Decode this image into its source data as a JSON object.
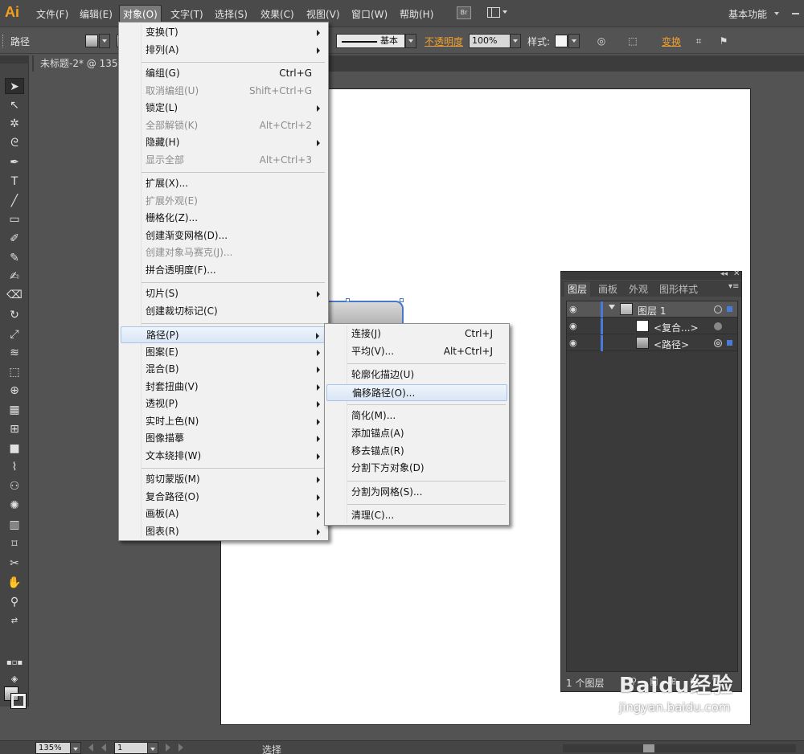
{
  "app": {
    "logo": "Ai",
    "workspace": "基本功能",
    "br_label": "Br"
  },
  "menubar": [
    "文件(F)",
    "编辑(E)",
    "对象(O)",
    "文字(T)",
    "选择(S)",
    "效果(C)",
    "视图(V)",
    "窗口(W)",
    "帮助(H)"
  ],
  "control": {
    "path_label": "路径",
    "stroke_style": "基本",
    "opacity_label": "不透明度",
    "opacity_value": "100%",
    "style_label": "样式:",
    "transform_label": "变换"
  },
  "document_tab": "未标题-2* @ 135%",
  "object_menu": [
    {
      "label": "变换(T)",
      "submenu": true
    },
    {
      "label": "排列(A)",
      "submenu": true
    },
    {
      "sep": true
    },
    {
      "label": "编组(G)",
      "shortcut": "Ctrl+G"
    },
    {
      "label": "取消编组(U)",
      "shortcut": "Shift+Ctrl+G",
      "disabled": true
    },
    {
      "label": "锁定(L)",
      "submenu": true
    },
    {
      "label": "全部解锁(K)",
      "shortcut": "Alt+Ctrl+2",
      "disabled": true
    },
    {
      "label": "隐藏(H)",
      "submenu": true
    },
    {
      "label": "显示全部",
      "shortcut": "Alt+Ctrl+3",
      "disabled": true
    },
    {
      "sep": true
    },
    {
      "label": "扩展(X)..."
    },
    {
      "label": "扩展外观(E)",
      "disabled": true
    },
    {
      "label": "栅格化(Z)..."
    },
    {
      "label": "创建渐变网格(D)..."
    },
    {
      "label": "创建对象马赛克(J)...",
      "disabled": true
    },
    {
      "label": "拼合透明度(F)..."
    },
    {
      "sep": true
    },
    {
      "label": "切片(S)",
      "submenu": true
    },
    {
      "label": "创建裁切标记(C)"
    },
    {
      "sep": true
    },
    {
      "label": "路径(P)",
      "submenu": true,
      "highlighted": true
    },
    {
      "label": "图案(E)",
      "submenu": true
    },
    {
      "label": "混合(B)",
      "submenu": true
    },
    {
      "label": "封套扭曲(V)",
      "submenu": true
    },
    {
      "label": "透视(P)",
      "submenu": true
    },
    {
      "label": "实时上色(N)",
      "submenu": true
    },
    {
      "label": "图像描摹",
      "submenu": true
    },
    {
      "label": "文本绕排(W)",
      "submenu": true
    },
    {
      "sep": true
    },
    {
      "label": "剪切蒙版(M)",
      "submenu": true
    },
    {
      "label": "复合路径(O)",
      "submenu": true
    },
    {
      "label": "画板(A)",
      "submenu": true
    },
    {
      "label": "图表(R)",
      "submenu": true
    }
  ],
  "path_submenu": [
    {
      "label": "连接(J)",
      "shortcut": "Ctrl+J"
    },
    {
      "label": "平均(V)...",
      "shortcut": "Alt+Ctrl+J"
    },
    {
      "sep": true
    },
    {
      "label": "轮廓化描边(U)"
    },
    {
      "label": "偏移路径(O)...",
      "highlighted": true
    },
    {
      "sep": true
    },
    {
      "label": "简化(M)..."
    },
    {
      "label": "添加锚点(A)"
    },
    {
      "label": "移去锚点(R)"
    },
    {
      "label": "分割下方对象(D)"
    },
    {
      "sep": true
    },
    {
      "label": "分割为网格(S)..."
    },
    {
      "sep": true
    },
    {
      "label": "清理(C)..."
    }
  ],
  "layers_panel": {
    "tabs": [
      "图层",
      "画板",
      "外观",
      "图形样式"
    ],
    "rows": [
      {
        "name": "图层 1"
      },
      {
        "name": "<复合...>"
      },
      {
        "name": "<路径>"
      }
    ],
    "footer": "1 个图层"
  },
  "status": {
    "zoom": "135%",
    "page": "1",
    "tool": "选择"
  },
  "watermark": {
    "main": "Baidu经验",
    "sub": "jingyan.baidu.com"
  }
}
